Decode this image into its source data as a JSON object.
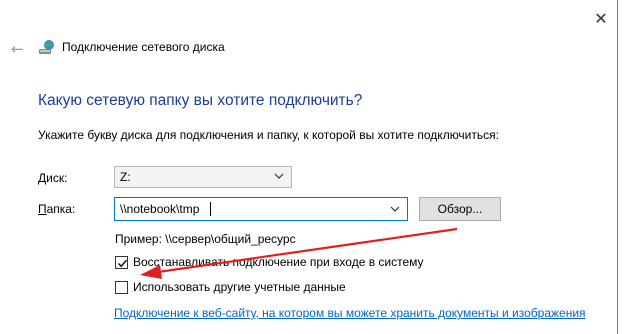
{
  "window": {
    "close_glyph": "✕",
    "back_glyph": "←",
    "title": "Подключение сетевого диска",
    "title_icon": "network-drive-globe-icon"
  },
  "main": {
    "heading": "Какую сетевую папку вы хотите подключить?",
    "instruction": "Укажите букву диска для подключения и папку, к которой вы хотите подключиться:"
  },
  "form": {
    "drive_label_first": "Д",
    "drive_label_rest": "иск:",
    "drive_value": "Z:",
    "folder_label_first": "П",
    "folder_label_rest": "апка:",
    "folder_value": "\\\\notebook\\tmp",
    "browse_label": "Обзор...",
    "example": "Пример: \\\\сервер\\общий_ресурс"
  },
  "options": {
    "reconnect_label": "Восстанавливать подключение при входе в систему",
    "reconnect_checked": true,
    "other_credentials_label": "Использовать другие учетные данные",
    "other_credentials_checked": false
  },
  "link": {
    "text": "Подключение к веб-сайту, на котором вы можете хранить документы и изображения"
  },
  "colors": {
    "heading": "#1c3d95",
    "link": "#0066cc",
    "focus_border": "#0078d7",
    "annotation_arrow": "#e02020"
  }
}
